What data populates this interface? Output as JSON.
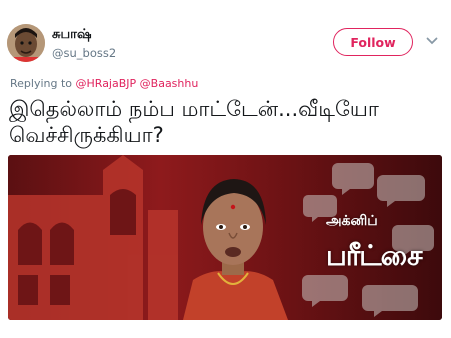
{
  "author": {
    "display_name": "சுபாஷ்",
    "handle": "@su_boss2"
  },
  "follow_button": {
    "label": "Follow",
    "color": "#e0245e"
  },
  "more_menu": {
    "icon": "chevron-down-icon"
  },
  "reply_context": {
    "prefix": "Replying to ",
    "mention_1": "@HRajaBJP",
    "mention_2": "@Baashhu"
  },
  "tweet": {
    "line_1": "இதெல்லாம் நம்ப மாட்டேன்...வீடியோ",
    "line_2": "வெச்சிருக்கியா?"
  },
  "media": {
    "overlay_line_1": "அக்னிப்",
    "overlay_line_2": "பரீட்சை"
  }
}
